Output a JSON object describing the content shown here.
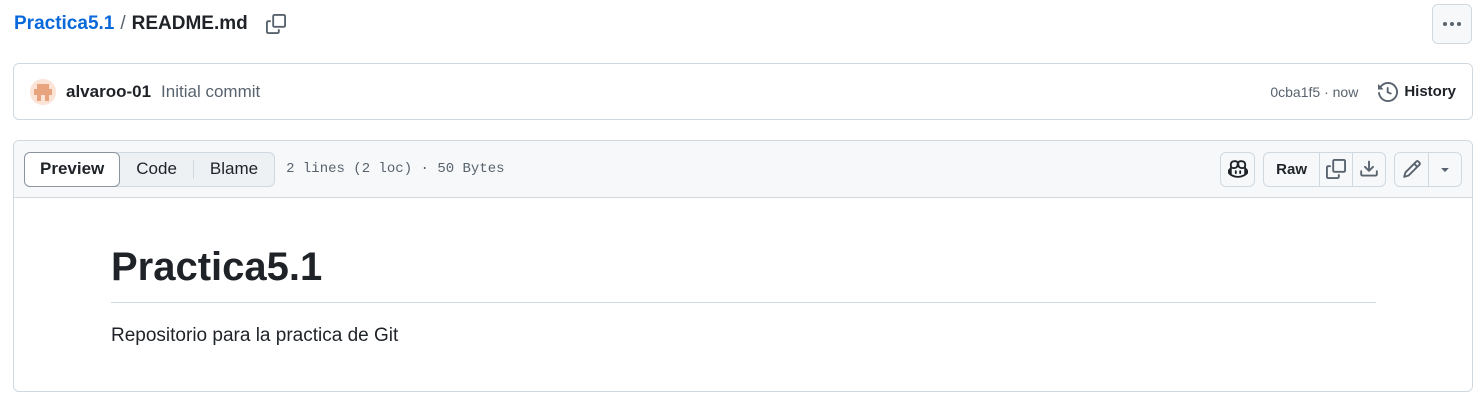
{
  "breadcrumb": {
    "repo": "Practica5.1",
    "separator": "/",
    "file": "README.md"
  },
  "commit": {
    "author": "alvaroo-01",
    "message": "Initial commit",
    "meta": "0cba1f5 · now",
    "history_label": "History"
  },
  "file_header": {
    "tabs": [
      {
        "label": "Preview",
        "active": true
      },
      {
        "label": "Code",
        "active": false
      },
      {
        "label": "Blame",
        "active": false
      }
    ],
    "info": "2 lines (2 loc) · 50 Bytes",
    "raw_label": "Raw"
  },
  "content": {
    "heading": "Practica5.1",
    "paragraph": "Repositorio para la practica de Git"
  },
  "icons": {
    "copy_path": "copy-icon",
    "more": "kebab-horizontal-icon",
    "history": "history-icon",
    "copilot": "copilot-icon",
    "copy_raw": "copy-icon",
    "download": "download-icon",
    "edit": "pencil-icon",
    "dropdown": "triangle-down-icon"
  },
  "colors": {
    "link": "#0969da",
    "text": "#1f2328",
    "muted": "#59636e",
    "border": "#d1d9e0",
    "header_bg": "#f6f8fa"
  }
}
